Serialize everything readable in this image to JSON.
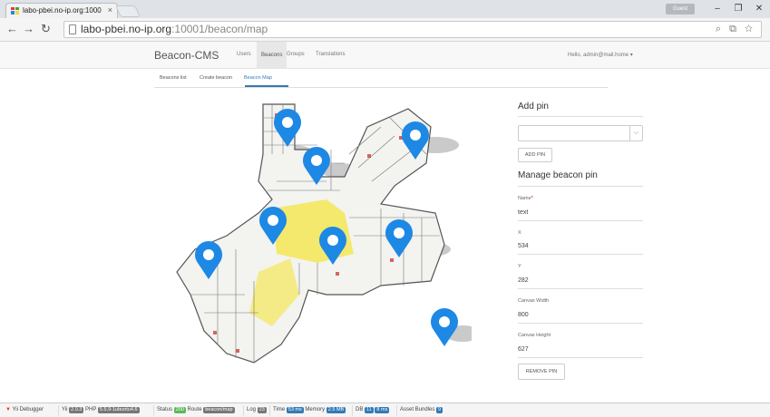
{
  "browser": {
    "tab_title": "labo-pbei.no-ip.org:1000",
    "url_host": "labo-pbei.no-ip.org",
    "url_path": ":10001/beacon/map",
    "user_label": "Guest"
  },
  "navbar": {
    "brand": "Beacon-CMS",
    "links": [
      "Users",
      "Beacons",
      "Groups",
      "Translations"
    ],
    "active": "Beacons",
    "user_menu": "Hello, admin@mail.home ▾"
  },
  "subtabs": {
    "items": [
      "Beacons list",
      "Create beacon",
      "Beacon Map"
    ],
    "active": "Beacon Map"
  },
  "add_pin": {
    "heading": "Add pin",
    "select_value": "",
    "button": "ADD PIN"
  },
  "manage_pin": {
    "heading": "Manage beacon pin",
    "fields": [
      {
        "label": "Name",
        "required": true,
        "value": "text"
      },
      {
        "label": "X",
        "required": false,
        "value": "534"
      },
      {
        "label": "Y",
        "required": false,
        "value": "282"
      },
      {
        "label": "Canvas Width",
        "required": false,
        "value": "800"
      },
      {
        "label": "Canvas Height",
        "required": false,
        "value": "627"
      }
    ],
    "remove_button": "REMOVE PIN"
  },
  "map": {
    "pin_color": "#1e88e5",
    "pin_count": 8
  },
  "debug": {
    "label": "Yii Debugger",
    "yii_version": "2.0.3",
    "php_version": "5.5.9-1ubuntu4.6",
    "status": "200",
    "route": "beacon/map",
    "log": "23",
    "time": "53 ms",
    "memory": "2.5 MB",
    "db_count": "11",
    "db_time": "8 ms",
    "asset_bundles": "9"
  }
}
